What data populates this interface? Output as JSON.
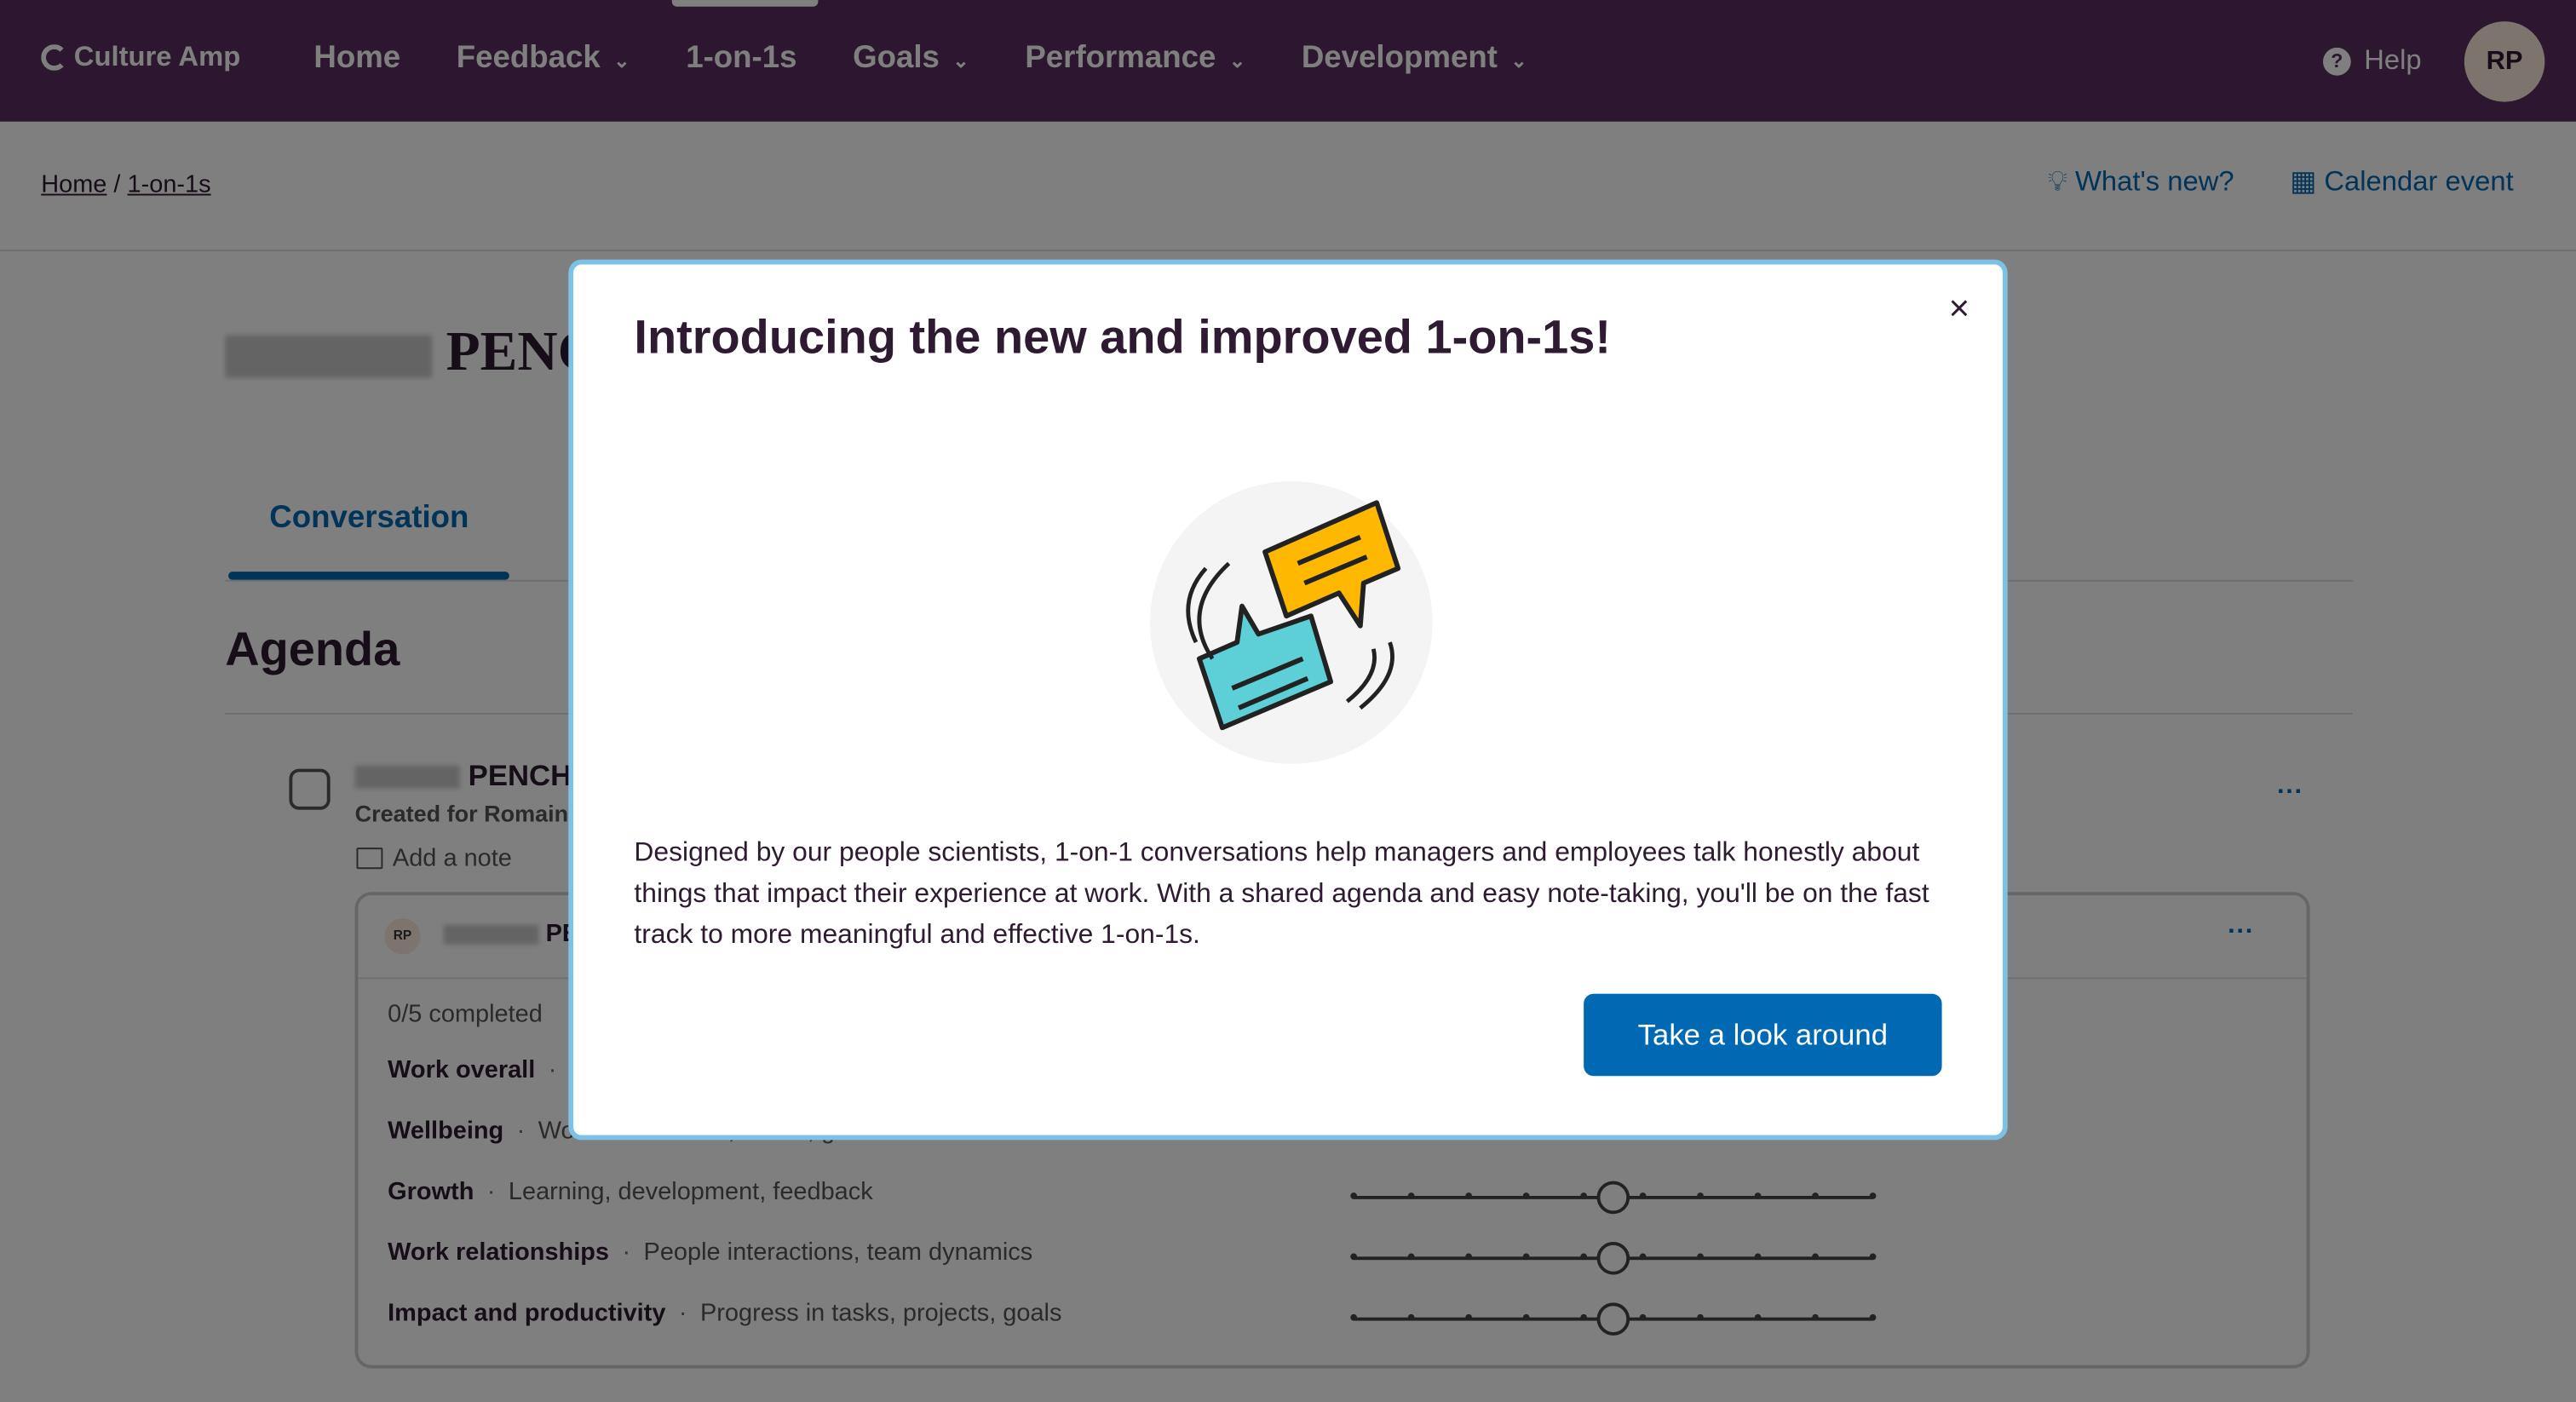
{
  "nav": {
    "brand": "Culture Amp",
    "items": [
      {
        "label": "Home",
        "dropdown": false
      },
      {
        "label": "Feedback",
        "dropdown": true
      },
      {
        "label": "1-on-1s",
        "dropdown": false,
        "active": true
      },
      {
        "label": "Goals",
        "dropdown": true
      },
      {
        "label": "Performance",
        "dropdown": true
      },
      {
        "label": "Development",
        "dropdown": true
      }
    ],
    "help": "Help",
    "avatar": "RP"
  },
  "breadcrumb": {
    "home": "Home",
    "sep": "/",
    "current": "1-on-1s"
  },
  "toplinks": {
    "whats_new": "What's new?",
    "calendar": "Calendar event"
  },
  "page": {
    "title": "PENCHE",
    "tab": "Conversation",
    "agenda": "Agenda"
  },
  "agenda_item": {
    "title": "PENCHE",
    "created": "Created for Romain",
    "add_note": "Add a note"
  },
  "card": {
    "avatar": "RP",
    "name": "PE",
    "completed": "0/5 completed",
    "rows": [
      {
        "label": "Work overall",
        "desc": ""
      },
      {
        "label": "Wellbeing",
        "desc": "Work-life balance, stress, general wellness"
      },
      {
        "label": "Growth",
        "desc": "Learning, development, feedback",
        "slider": 0.5
      },
      {
        "label": "Work relationships",
        "desc": "People interactions, team dynamics",
        "slider": 0.5
      },
      {
        "label": "Impact and productivity",
        "desc": "Progress in tasks, projects, goals",
        "slider": 0.5
      }
    ]
  },
  "modal": {
    "title": "Introducing the new and improved 1-on-1s!",
    "body": "Designed by our people scientists, 1-on-1 conversations help managers and employees talk honestly about things that impact their experience at work. With a shared agenda and easy note-taking, you'll be on the fast track to more meaningful and effective 1-on-1s.",
    "cta": "Take a look around",
    "close": "×"
  },
  "colors": {
    "nav": "#5a2d5e",
    "accent": "#0168b3",
    "modal_border": "#7cc2e6",
    "bubble_yellow": "#ffb800",
    "bubble_teal": "#5dcfd7"
  }
}
